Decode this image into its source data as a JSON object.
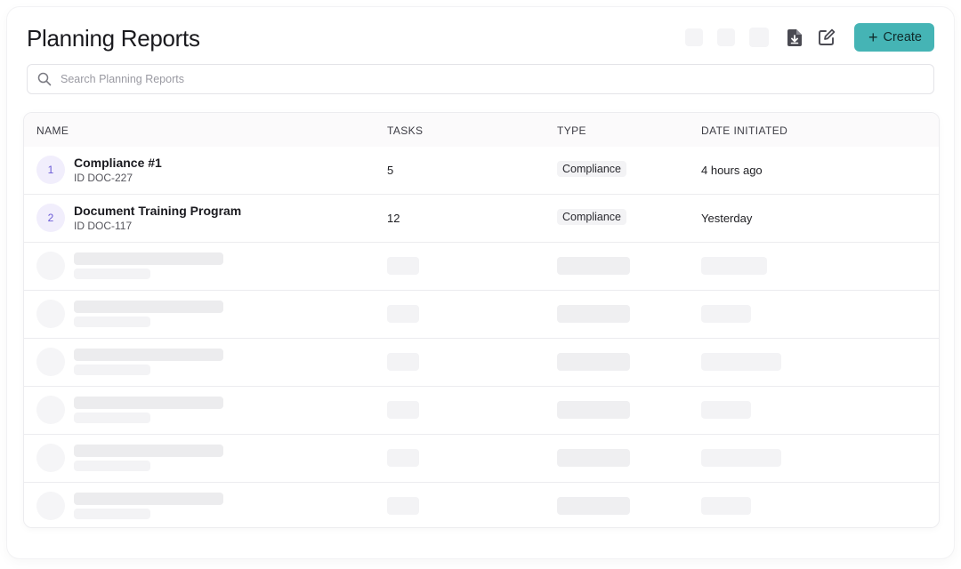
{
  "page": {
    "title": "Planning Reports"
  },
  "toolbar": {
    "create_label": "Create",
    "create_plus": "+"
  },
  "search": {
    "placeholder": "Search Planning Reports",
    "value": ""
  },
  "table": {
    "columns": {
      "name": "NAME",
      "tasks": "TASKS",
      "type": "TYPE",
      "date": "DATE INITIATED"
    },
    "rows": [
      {
        "index": "1",
        "name": "Compliance #1",
        "id": "ID DOC-227",
        "tasks": "5",
        "type": "Compliance",
        "date": "4 hours ago"
      },
      {
        "index": "2",
        "name": "Document Training Program",
        "id": "ID DOC-117",
        "tasks": "12",
        "type": "Compliance",
        "date": "Yesterday"
      }
    ]
  },
  "colors": {
    "accent": "#45b4b5",
    "index_badge_bg": "#f1eefc",
    "index_badge_text": "#6b5bd6"
  },
  "icons": {
    "search": "search-icon",
    "download": "file-download-icon",
    "edit": "edit-icon"
  }
}
